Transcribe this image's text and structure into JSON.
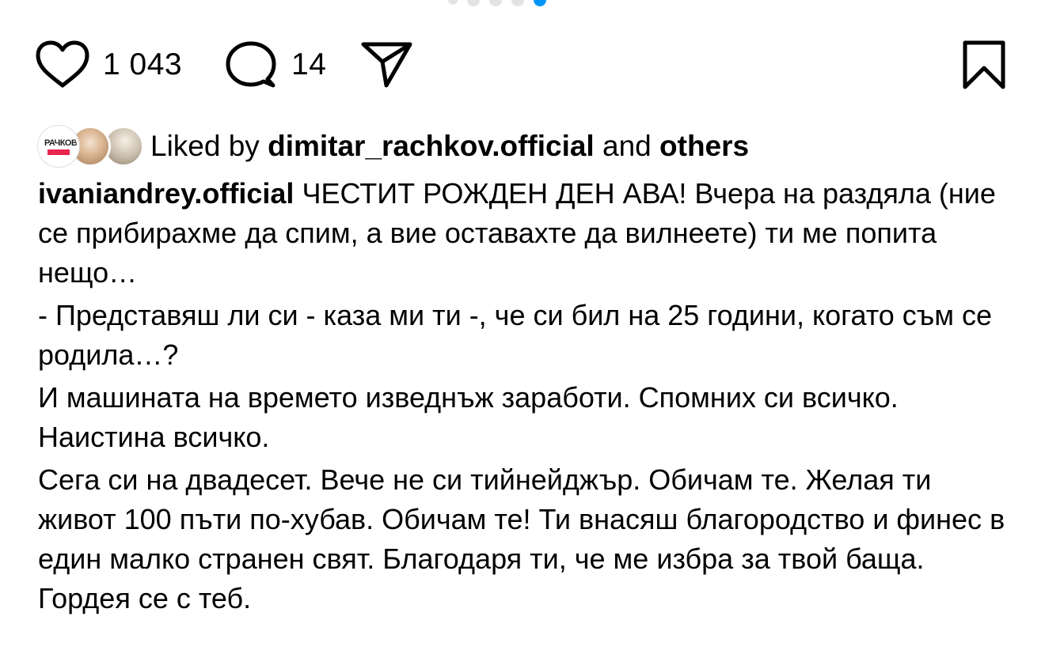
{
  "carousel": {
    "count": 5,
    "active_index": 4
  },
  "actions": {
    "like_icon": "heart-outline-icon",
    "like_count": "1 043",
    "comment_icon": "comment-bubble-icon",
    "comment_count": "14",
    "share_icon": "paper-plane-icon",
    "save_icon": "bookmark-outline-icon"
  },
  "liked_by": {
    "prefix": "Liked by",
    "user": "dimitar_rachkov.official",
    "middle": "and",
    "others": "others",
    "avatar1_text": "РАЧКОВ"
  },
  "caption": {
    "username": "ivaniandrey.official",
    "paragraphs": [
      "ЧЕСТИТ РОЖДЕН ДЕН АВА! Вчера на раздяла (ние се прибирахме да спим, а вие оставахте да вилнеете) ти ме попита нещо…",
      "- Представяш ли си - каза ми ти -, че си бил на 25 години, когато съм се родила…?",
      "И машината на времето изведнъж заработи. Спомних си всичко. Наистина всичко.",
      "Сега си на двадесет. Вече не си тийнейджър. Обичам те. Желая ти живот 100 пъти по-хубав. Обичам те! Ти внасяш благородство и финес в един малко странен свят. Благодаря ти, че ме избра за твой баща. Гордея се с теб."
    ]
  },
  "colors": {
    "text": "#000000",
    "accent": "#0095f6",
    "dot_inactive": "#e3e3e3"
  }
}
